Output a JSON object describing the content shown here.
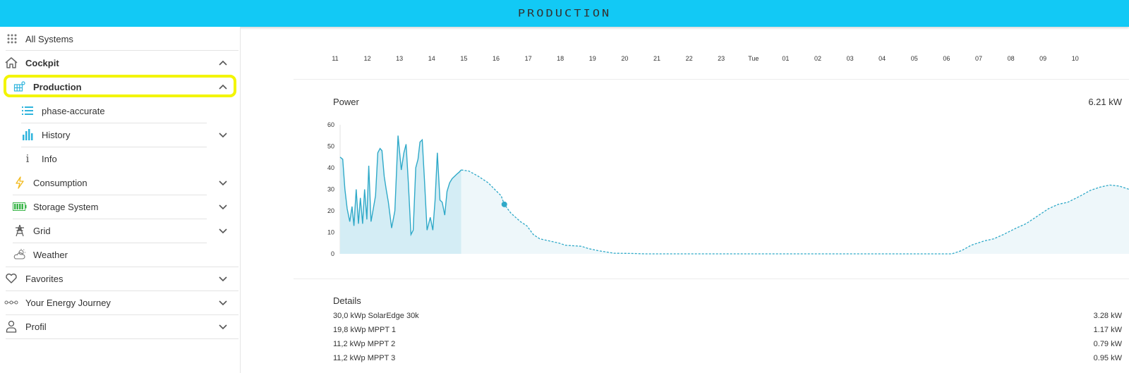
{
  "header": {
    "title": "PRODUCTION"
  },
  "sidebar": {
    "all_systems": "All Systems",
    "cockpit": "Cockpit",
    "production": "Production",
    "phase_accurate": "phase-accurate",
    "history": "History",
    "info": "Info",
    "consumption": "Consumption",
    "storage_system": "Storage System",
    "grid": "Grid",
    "weather": "Weather",
    "favorites": "Favorites",
    "energy_journey": "Your Energy Journey",
    "profil": "Profil"
  },
  "timeline": {
    "hours": [
      "11",
      "12",
      "13",
      "14",
      "15",
      "16",
      "17",
      "18",
      "19",
      "20",
      "21",
      "22",
      "23",
      "Tue",
      "01",
      "02",
      "03",
      "04",
      "05",
      "06",
      "07",
      "08",
      "09",
      "10"
    ]
  },
  "power": {
    "title": "Power",
    "current_value": "6.21 kW"
  },
  "chart_data": {
    "type": "area",
    "yticks": [
      0,
      10,
      20,
      30,
      40,
      50,
      60
    ],
    "ylim": [
      0,
      60
    ],
    "xlim": [
      11,
      35.5
    ],
    "x_unit": "hour (11:00 → 10:30 next day)",
    "series": [
      {
        "style": "solid-filled",
        "x": [
          11.0,
          11.08,
          11.15,
          11.22,
          11.3,
          11.37,
          11.43,
          11.5,
          11.57,
          11.63,
          11.7,
          11.76,
          11.83,
          11.89,
          11.96,
          12.02,
          12.1,
          12.17,
          12.24,
          12.3,
          12.37,
          12.43,
          12.5,
          12.6,
          12.7,
          12.8,
          12.9,
          12.98,
          13.05,
          13.12,
          13.2,
          13.27,
          13.35,
          13.42,
          13.48,
          13.55,
          13.62,
          13.7,
          13.8,
          13.88,
          13.95,
          14.02,
          14.1,
          14.17,
          14.25,
          14.32,
          14.4,
          14.48,
          14.55,
          14.62,
          14.7,
          14.76
        ],
        "values": [
          45,
          44,
          30,
          21,
          15,
          22,
          13,
          30,
          14,
          26,
          14,
          30,
          16,
          41,
          15,
          20,
          27,
          47,
          49,
          48,
          36,
          30,
          24,
          12,
          20,
          55,
          39,
          47,
          51,
          33,
          9,
          11,
          40,
          44,
          52,
          53,
          34,
          11,
          17,
          11,
          25,
          47,
          25,
          24,
          18,
          29,
          33,
          35,
          36,
          37,
          38,
          39
        ]
      },
      {
        "style": "dashed-forecast",
        "x": [
          14.76,
          15.0,
          15.3,
          15.6,
          15.8,
          16.0,
          16.1,
          16.3,
          16.6,
          16.8,
          17.0,
          17.2,
          17.5,
          17.8,
          18.0,
          18.5,
          18.7,
          19.0,
          19.3,
          19.5,
          20.0,
          20.5,
          21,
          22,
          23,
          24,
          25,
          26,
          27,
          28,
          29,
          30,
          30.3,
          30.6,
          31.0,
          31.3,
          31.6,
          32.0,
          32.3,
          32.6,
          33.0,
          33.3,
          33.6,
          34.0,
          34.3,
          34.6,
          34.9,
          35.2,
          35.5
        ],
        "values": [
          39,
          38.5,
          36,
          33,
          30,
          27,
          23,
          19,
          15,
          13,
          9,
          7,
          6,
          5,
          4,
          3.5,
          2.5,
          1.5,
          0.8,
          0.3,
          0.2,
          0,
          0,
          0,
          0,
          0,
          0,
          0,
          0,
          0,
          0,
          0,
          1.5,
          4,
          6,
          7,
          9,
          12,
          14,
          17,
          21,
          23,
          24,
          27,
          29.5,
          31,
          32,
          31.5,
          30
        ]
      }
    ],
    "marker": {
      "x": 16.1,
      "y": 23
    },
    "colors": {
      "line": "#2fa9c8",
      "fill": "#d4edf5",
      "forecast_fill": "#eef7fa"
    }
  },
  "details": {
    "title": "Details",
    "rows": [
      {
        "label": "30,0 kWp SolarEdge 30k",
        "value": "3.28 kW"
      },
      {
        "label": "19,8 kWp MPPT 1",
        "value": "1.17 kW"
      },
      {
        "label": "11,2 kWp MPPT 2",
        "value": "0.79 kW"
      },
      {
        "label": "11,2 kWp MPPT 3",
        "value": "0.95 kW"
      }
    ]
  },
  "colors": {
    "header_bg": "#12c9f5",
    "highlight": "#f3f500",
    "accent": "#2fa9c8"
  }
}
